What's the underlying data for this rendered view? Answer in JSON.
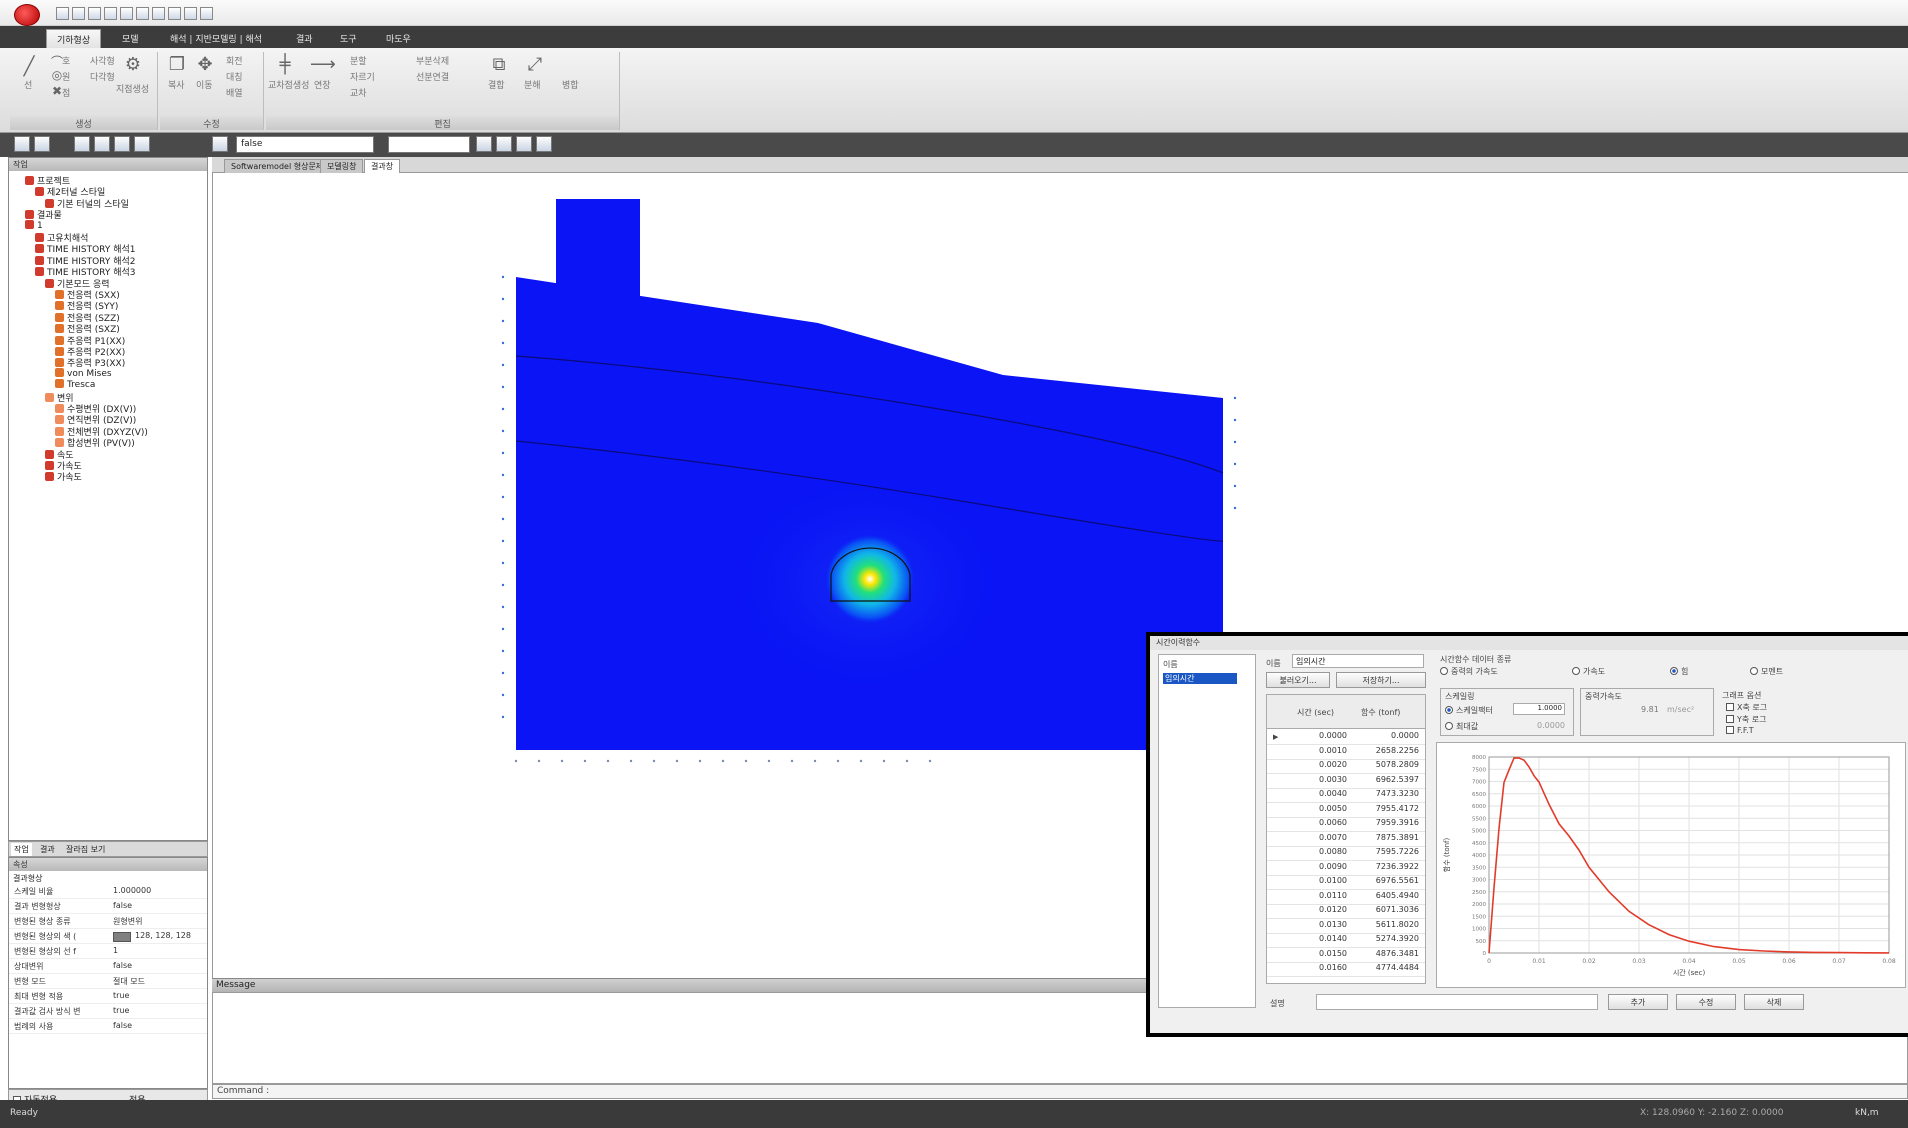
{
  "titlebar": {
    "quick_access_icons": [
      "new-file-icon",
      "open-folder-icon",
      "save-icon",
      "save-as-icon",
      "import-icon",
      "export-icon",
      "print-icon",
      "undo-icon",
      "redo-icon",
      "help-icon"
    ]
  },
  "ribbon": {
    "tabs": [
      "기하형상",
      "모델",
      "해석 | 지반모델링 | 해석",
      "결과",
      "도구",
      "마도우"
    ],
    "groups": [
      {
        "label": "생성",
        "buttons": [
          "선",
          "호",
          "사각형",
          "원",
          "다각형",
          "점",
          "지점생성"
        ]
      },
      {
        "label": "수정",
        "buttons": [
          "복사",
          "이동",
          "회전",
          "대칭",
          "배열"
        ]
      },
      {
        "label": "편집",
        "buttons": [
          "교차점생성",
          "연장",
          "분할",
          "자르기",
          "교차",
          "부분삭제",
          "선분연결",
          "결합",
          "분해",
          "병합"
        ]
      }
    ]
  },
  "toolbar": {
    "select_value": "false"
  },
  "tree": {
    "header": "작업",
    "items": [
      "프로젝트",
      "제2터널 스타일",
      "기본 터널의 스타일",
      "결과물",
      "1",
      "고유치해석",
      "TIME HISTORY 해석1",
      "TIME HISTORY 해석2",
      "TIME HISTORY 해석3",
      "기본모드 응력",
      "전응력 (SXX)",
      "전응력 (SYY)",
      "전응력 (SZZ)",
      "전응력 (SXZ)",
      "주응력 P1(XX)",
      "주응력 P2(XX)",
      "주응력 P3(XX)",
      "von Mises",
      "Tresca",
      "변위",
      "수평변위 (DX(V))",
      "연직변위 (DZ(V))",
      "전체변위 (DXYZ(V))",
      "합성변위 (PV(V))",
      "속도",
      "가속도",
      "가속도"
    ]
  },
  "left_tabs": [
    "작업",
    "결과",
    "잘라짐 보기"
  ],
  "properties": {
    "header": "속성",
    "section": "결과형상",
    "rows": [
      {
        "key": "스케일 비율",
        "value": "1.000000"
      },
      {
        "key": "결과 변형형상",
        "value": "false"
      },
      {
        "key": "변형된 형상 종류",
        "value": "원형변위"
      },
      {
        "key": "변형된 형상의 색 (",
        "value": "128, 128, 128"
      },
      {
        "key": "변형된 형상의 선 f",
        "value": "1"
      },
      {
        "key": "상대변위",
        "value": "false"
      },
      {
        "key": "변형 모드",
        "value": "절대 모드"
      },
      {
        "key": "최대 변형 적용",
        "value": "true"
      },
      {
        "key": "결과값 검사 방식 변",
        "value": "true"
      },
      {
        "key": "범례의 사용",
        "value": "false"
      }
    ],
    "checkbox_label": "자동적용",
    "apply_label": "적용"
  },
  "doc_tabs": [
    "Softwaremodel 형상문제",
    "모델링창",
    "결과창"
  ],
  "message_header": "Message",
  "command_label": "Command :",
  "status": {
    "left": "Ready",
    "right_coords": "X: 128.0960  Y: -2.160  Z: 0.0000",
    "right_unit": "kN,m"
  },
  "dialog": {
    "title": "시간이력함수",
    "list_header": "이름",
    "list_selected": "임의시간",
    "name_label": "이름",
    "name_value": "임의시간",
    "load_button": "불러오기...",
    "save_button": "저장하기...",
    "table_headers": [
      "시간 (sec)",
      "함수 (tonf)"
    ],
    "table_rows": [
      [
        "0.0000",
        "0.0000"
      ],
      [
        "0.0010",
        "2658.2256"
      ],
      [
        "0.0020",
        "5078.2809"
      ],
      [
        "0.0030",
        "6962.5397"
      ],
      [
        "0.0040",
        "7473.3230"
      ],
      [
        "0.0050",
        "7955.4172"
      ],
      [
        "0.0060",
        "7959.3916"
      ],
      [
        "0.0070",
        "7875.3891"
      ],
      [
        "0.0080",
        "7595.7226"
      ],
      [
        "0.0090",
        "7236.3922"
      ],
      [
        "0.0100",
        "6976.5561"
      ],
      [
        "0.0110",
        "6405.4940"
      ],
      [
        "0.0120",
        "6071.3036"
      ],
      [
        "0.0130",
        "5611.8020"
      ],
      [
        "0.0140",
        "5274.3920"
      ],
      [
        "0.0150",
        "4876.3481"
      ],
      [
        "0.0160",
        "4774.4484"
      ]
    ],
    "data_type_label": "시간함수 데이터 종류",
    "radio_options": [
      "중력의 가속도",
      "가속도",
      "힘",
      "모멘트"
    ],
    "radio_selected_index": 2,
    "scale_label": "스케일링",
    "scale_factor_label": "스케일팩터",
    "scale_factor_value": "1.0000",
    "max_value_label": "최대값",
    "max_value_value": "0.0000",
    "gravity_label": "중력가속도",
    "gravity_value": "9.81",
    "gravity_unit": "m/sec²",
    "graph_option_label": "그래프 옵션",
    "graph_options": [
      "X축 로그",
      "Y축 로그",
      "F.F.T"
    ],
    "description_label": "설명",
    "footer_buttons": [
      "추가",
      "수정",
      "삭제"
    ]
  },
  "chart_data": {
    "type": "line",
    "title": "",
    "xlabel": "시간 (sec)",
    "ylabel": "함수 (tonf)",
    "xlim": [
      0,
      0.08
    ],
    "ylim": [
      0,
      8000
    ],
    "x_ticks": [
      "0",
      "0.01",
      "0.02",
      "0.03",
      "0.04",
      "0.05",
      "0.06",
      "0.07",
      "0.08"
    ],
    "y_ticks": [
      "0",
      "500",
      "1000",
      "1500",
      "2000",
      "2500",
      "3000",
      "3500",
      "4000",
      "4500",
      "5000",
      "5500",
      "6000",
      "6500",
      "7000",
      "7500",
      "8000"
    ],
    "grid": true,
    "series": [
      {
        "color": "#e23b2a",
        "x": [
          0,
          0.001,
          0.002,
          0.003,
          0.004,
          0.005,
          0.006,
          0.007,
          0.008,
          0.009,
          0.01,
          0.012,
          0.014,
          0.016,
          0.018,
          0.02,
          0.024,
          0.028,
          0.032,
          0.036,
          0.04,
          0.045,
          0.05,
          0.055,
          0.06,
          0.065,
          0.07,
          0.075,
          0.08
        ],
        "y": [
          0,
          2658,
          5078,
          6963,
          7473,
          7955,
          7959,
          7875,
          7596,
          7236,
          6977,
          6071,
          5274,
          4774,
          4200,
          3500,
          2500,
          1700,
          1150,
          750,
          480,
          260,
          140,
          80,
          45,
          25,
          15,
          8,
          5
        ]
      }
    ]
  },
  "colors": {
    "model_fill": "#0a14f5",
    "hotspot": "#ffe600",
    "series": "#e23b2a",
    "dark_bar": "#3c3c3c"
  }
}
